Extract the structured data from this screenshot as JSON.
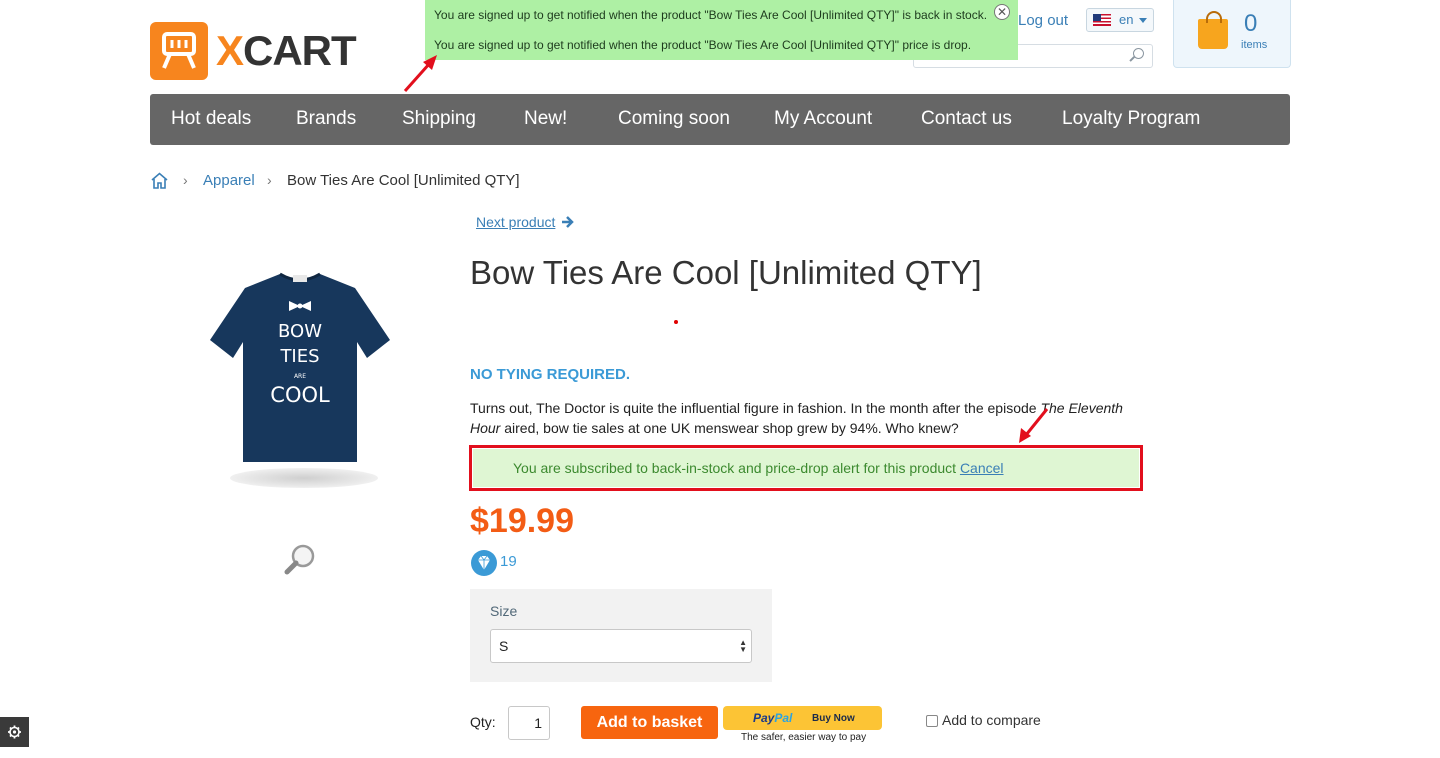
{
  "header": {
    "logo_text_x": "X",
    "logo_text_rest": "CART",
    "logout_label": "Log out",
    "language": "en",
    "cart_count": "0",
    "cart_items_label": "items"
  },
  "notifications": {
    "back_in_stock": "You are signed up to get notified when the product \"Bow Ties Are Cool [Unlimited QTY]\" is back in stock.",
    "price_drop": "You are signed up to get notified when the product \"Bow Ties Are Cool [Unlimited QTY]\" price is drop."
  },
  "nav": {
    "items": [
      {
        "label": "Hot deals"
      },
      {
        "label": "Brands"
      },
      {
        "label": "Shipping"
      },
      {
        "label": "New!"
      },
      {
        "label": "Coming soon"
      },
      {
        "label": "My Account"
      },
      {
        "label": "Contact us"
      },
      {
        "label": "Loyalty Program"
      }
    ]
  },
  "breadcrumb": {
    "category": "Apparel",
    "current": "Bow Ties Are Cool [Unlimited QTY]"
  },
  "product": {
    "next_label": "Next product",
    "title": "Bow Ties Are Cool [Unlimited QTY]",
    "tagline": "NO TYING REQUIRED.",
    "desc_part1": "Turns out, The Doctor is quite the influential figure in fashion. In the month after the episode ",
    "desc_italic": "The Eleventh Hour",
    "desc_part2": " aired, bow tie sales at one UK menswear shop grew by 94%. Who knew?",
    "alert_text": "You are subscribed to back-in-stock and price-drop alert for this product ",
    "alert_cancel": "Cancel",
    "price": "$19.99",
    "reward_points": "19",
    "image_text": [
      "BOW",
      "TIES",
      "ARE",
      "COOL"
    ]
  },
  "options": {
    "size_label": "Size",
    "size_value": "S"
  },
  "purchase": {
    "qty_label": "Qty:",
    "qty_value": "1",
    "add_to_basket": "Add to basket",
    "paypal_brand_pay": "Pay",
    "paypal_brand_pal": "Pal",
    "paypal_buy_now": "Buy Now",
    "paypal_sub": "The safer, easier way to pay",
    "compare_label": "Add to compare"
  },
  "colors": {
    "accent_orange": "#f7650f",
    "price_orange": "#f35c15",
    "link_blue": "#3a7fb6",
    "nav_gray": "#666666",
    "notify_green": "#aef0a4",
    "annotation_red": "#e20f1d"
  }
}
